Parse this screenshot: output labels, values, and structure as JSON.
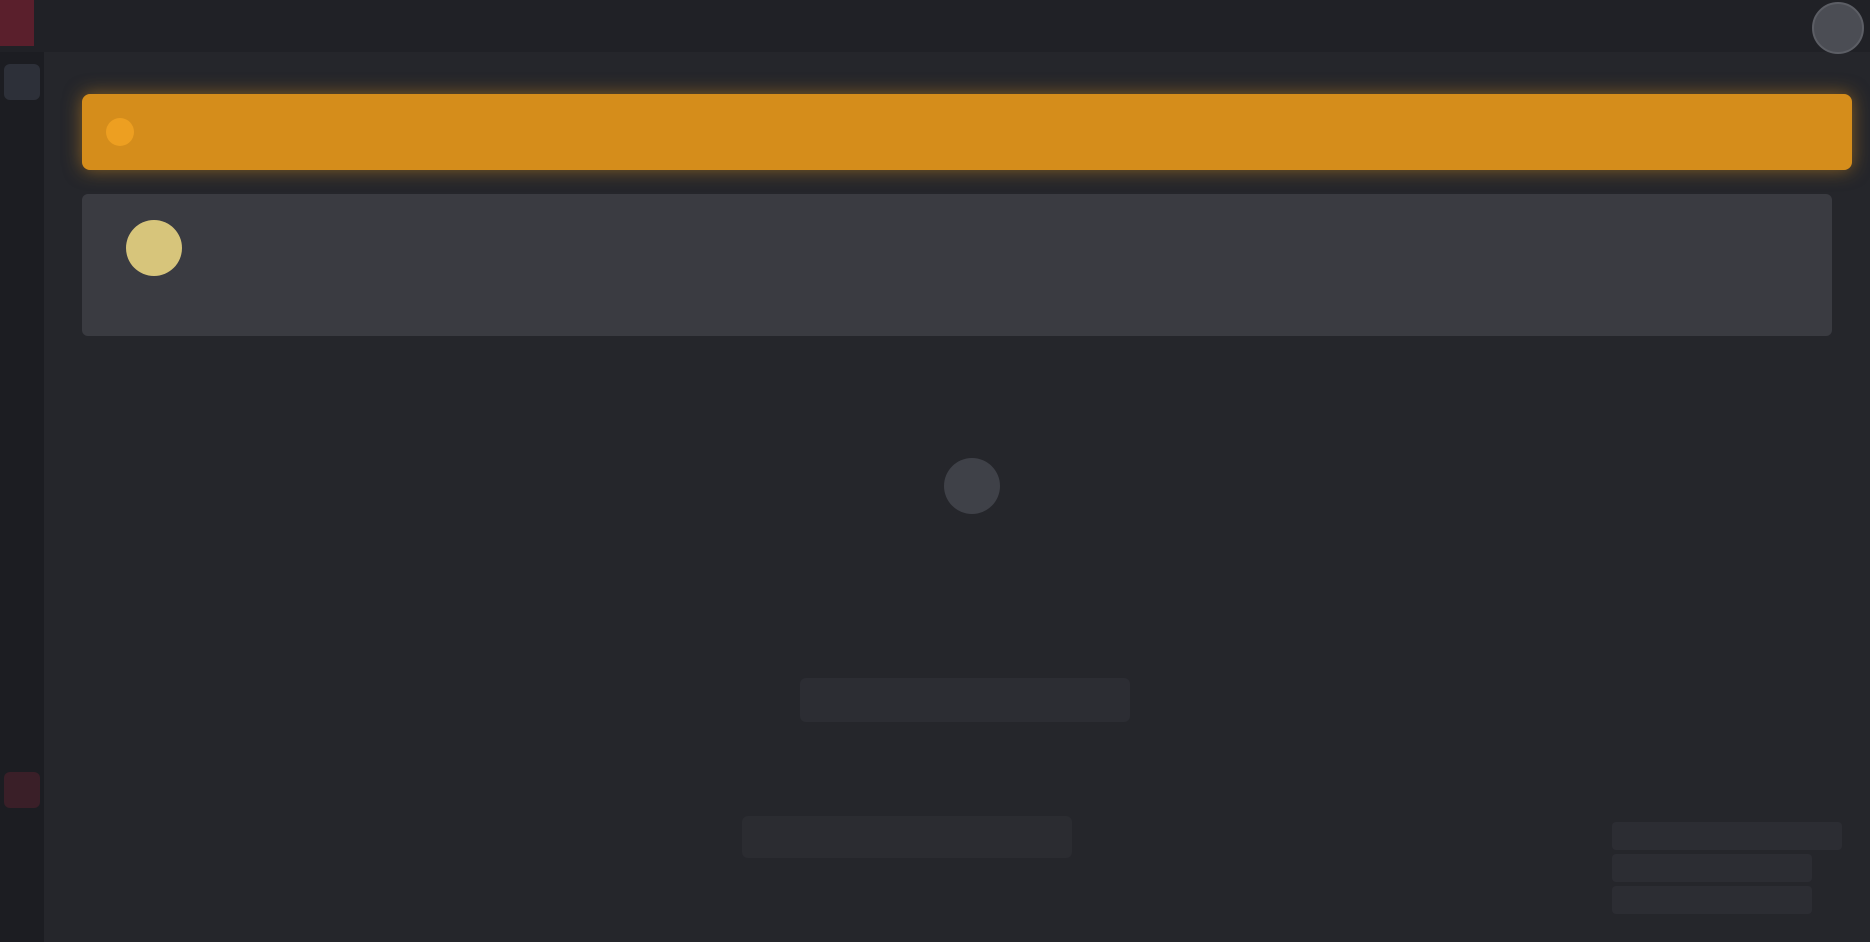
{
  "titlebar": {
    "title": ""
  },
  "banner": {
    "text": ""
  },
  "profile": {
    "name": "",
    "subtitle": ""
  },
  "section": {
    "title": ""
  },
  "empty_state": {
    "label": ""
  },
  "rows": {
    "first_label": "",
    "second_label": ""
  },
  "center_button": {
    "label": ""
  },
  "center_field": {
    "value": ""
  },
  "right_list": [
    "",
    "",
    ""
  ],
  "colors": {
    "background": "#25262b",
    "banner": "#d58d1b",
    "card": "#3a3b41",
    "avatar": "#d7c57b"
  }
}
